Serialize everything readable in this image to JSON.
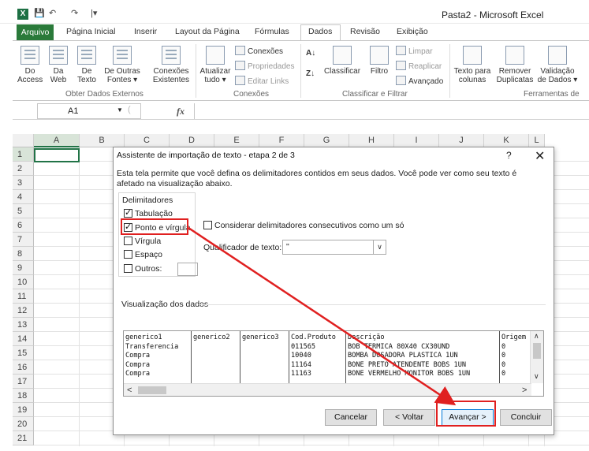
{
  "window": {
    "title": "Pasta2  -  Microsoft Excel",
    "quick_access": [
      "↶",
      "↷",
      "|▾"
    ]
  },
  "tabs": {
    "file": "Arquivo",
    "items": [
      "Página Inicial",
      "Inserir",
      "Layout da Página",
      "Fórmulas",
      "Dados",
      "Revisão",
      "Exibição"
    ],
    "active": "Dados"
  },
  "ribbon": {
    "obter": {
      "access": "Do\nAccess",
      "web": "Da\nWeb",
      "texto": "De\nTexto",
      "outras": "De Outras\nFontes ▾",
      "existentes": "Conexões\nExistentes",
      "label": "Obter Dados Externos"
    },
    "conexoes": {
      "atualizar": "Atualizar\ntudo ▾",
      "conexoes": "Conexões",
      "propriedades": "Propriedades",
      "editar": "Editar Links",
      "label": "Conexões"
    },
    "classificar": {
      "classificar": "Classificar",
      "filtro": "Filtro",
      "limpar": "Limpar",
      "reaplicar": "Reaplicar",
      "avancado": "Avançado",
      "label": "Classificar e Filtrar"
    },
    "ferramentas": {
      "texto_colunas": "Texto para\ncolunas",
      "remover": "Remover\nDuplicatas",
      "validacao": "Validação\nde Dados ▾",
      "label": "Ferramentas de"
    }
  },
  "formula_bar": {
    "name_box": "A1",
    "fx": "fx"
  },
  "grid": {
    "columns": [
      "A",
      "B",
      "C",
      "D",
      "E",
      "F",
      "G",
      "H",
      "I",
      "J",
      "K",
      "L"
    ],
    "rows": [
      "1",
      "2",
      "3",
      "4",
      "5",
      "6",
      "7",
      "8",
      "9",
      "10",
      "11",
      "12",
      "13",
      "14",
      "15",
      "16",
      "17",
      "18",
      "19",
      "20",
      "21"
    ]
  },
  "dialog": {
    "title": "Assistente de importação de texto - etapa 2 de 3",
    "help": "?",
    "close": "✕",
    "intro": "Esta tela permite que você defina os delimitadores contidos em seus dados. Você pode ver como seu texto é afetado na visualização abaixo.",
    "delimiters_legend": "Delimitadores",
    "delimiters": [
      {
        "label": "Tabulação",
        "checked": true
      },
      {
        "label": "Ponto e vírgula",
        "checked": true
      },
      {
        "label": "Vírgula",
        "checked": false
      },
      {
        "label": "Espaço",
        "checked": false
      },
      {
        "label": "Outros:",
        "checked": false
      }
    ],
    "consecutive": "Considerar delimitadores consecutivos como um só",
    "qualifier_label": "Qualificador de texto:",
    "qualifier_value": "\"",
    "preview_label": "Visualização dos dados",
    "preview_columns": [
      [
        "generico1",
        "Transferencia",
        "Compra",
        "Compra",
        "Compra"
      ],
      [
        "generico2",
        "",
        "",
        "",
        ""
      ],
      [
        "generico3",
        "",
        "",
        "",
        ""
      ],
      [
        "Cod.Produto",
        "011565",
        "10040",
        "11164",
        "11163"
      ],
      [
        "Descrição",
        "BOB TERMICA 80X40 CX30UND",
        "BOMBA DOSADORA PLASTICA 1UN",
        "BONE PRETO ATENDENTE  BOBS 1UN",
        "BONE VERMELHO MONITOR BOBS 1UN"
      ],
      [
        "Origem",
        "0",
        "0",
        "0",
        "0"
      ]
    ],
    "buttons": {
      "cancel": "Cancelar",
      "back": "< Voltar",
      "next": "Avançar >",
      "finish": "Concluir"
    }
  },
  "colors": {
    "excel_green": "#217346",
    "file_tab": "#2a7a3a",
    "annotation_red": "#e02020",
    "primary_button": "#0078d7"
  }
}
